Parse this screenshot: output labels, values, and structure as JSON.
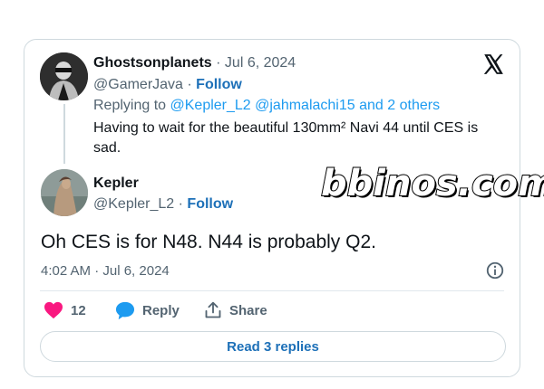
{
  "quoted_tweet": {
    "author_name": "Ghostsonplanets",
    "separator": "·",
    "date": "Jul 6, 2024",
    "handle": "@GamerJava",
    "dot": "·",
    "follow_label": "Follow",
    "replying_prefix": "Replying to",
    "mentions": "@Kepler_L2 @jahmalachi15",
    "replying_suffix": "and 2 others",
    "text": "Having to wait for the beautiful 130mm² Navi 44 until CES is sad."
  },
  "main_tweet": {
    "author_name": "Kepler",
    "handle": "@Kepler_L2",
    "dot": "·",
    "follow_label": "Follow",
    "text": "Oh CES is for N48. N44 is probably Q2.",
    "timestamp": "4:02 AM · Jul 6, 2024"
  },
  "actions": {
    "like_count": "12",
    "reply_label": "Reply",
    "share_label": "Share"
  },
  "read_replies_label": "Read 3 replies",
  "watermark": "bbinos.com",
  "colors": {
    "link": "#1d70b8",
    "mention": "#1d9bf0",
    "heart": "#f91880",
    "reply_bubble": "#1d9bf0"
  }
}
